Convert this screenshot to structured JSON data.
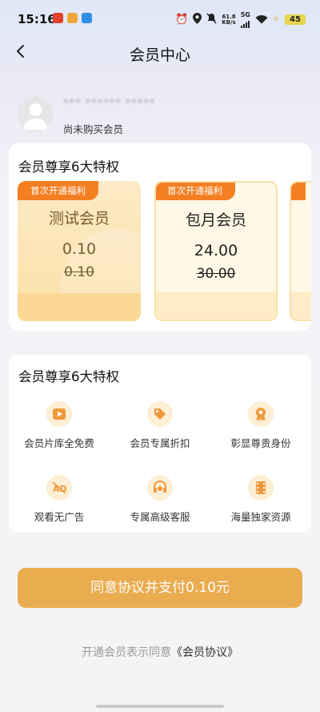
{
  "status_bar": {
    "time": "15:16",
    "net_speed_value": "61.8",
    "net_speed_unit": "KB/s",
    "network": "5G",
    "battery": "45",
    "icons": [
      "weibo-app-icon",
      "clock-app-icon",
      "translate-app-icon",
      "alarm-icon",
      "location-icon",
      "mute-icon",
      "signal-icon",
      "wifi-icon",
      "charging-icon"
    ]
  },
  "header": {
    "title": "会员中心",
    "back_icon": "chevron-left-icon"
  },
  "user": {
    "name": "*** ****** *****",
    "status": "尚未购买会员"
  },
  "plans_section": {
    "title": "会员尊享6大特权",
    "plans": [
      {
        "badge": "首次开通福利",
        "name": "测试会员",
        "price": "0.10",
        "original_price": "0.10",
        "selected": true
      },
      {
        "badge": "首次开通福利",
        "name": "包月会员",
        "price": "24.00",
        "original_price": "30.00",
        "selected": false
      }
    ]
  },
  "benefits_section": {
    "title": "会员尊享6大特权",
    "items": [
      {
        "icon": "play-icon",
        "label": "会员片库全免费"
      },
      {
        "icon": "discount-tag-icon",
        "label": "会员专属折扣"
      },
      {
        "icon": "medal-icon",
        "label": "彰显尊贵身份"
      },
      {
        "icon": "no-ads-icon",
        "label": "观看无广告"
      },
      {
        "icon": "customer-service-icon",
        "label": "专属高级客服"
      },
      {
        "icon": "film-strip-icon",
        "label": "海量独家资源"
      }
    ]
  },
  "pay_button": {
    "label": "同意协议并支付0.10元"
  },
  "agreement": {
    "text": "开通会员表示同意",
    "link": "《会员协议》"
  },
  "colors": {
    "accent": "#e9ac4f",
    "badge": "#f47f22",
    "icon_bg": "#fdeed4",
    "icon_fg": "#ee9a3c",
    "strong_text": "#7a5a2d"
  }
}
